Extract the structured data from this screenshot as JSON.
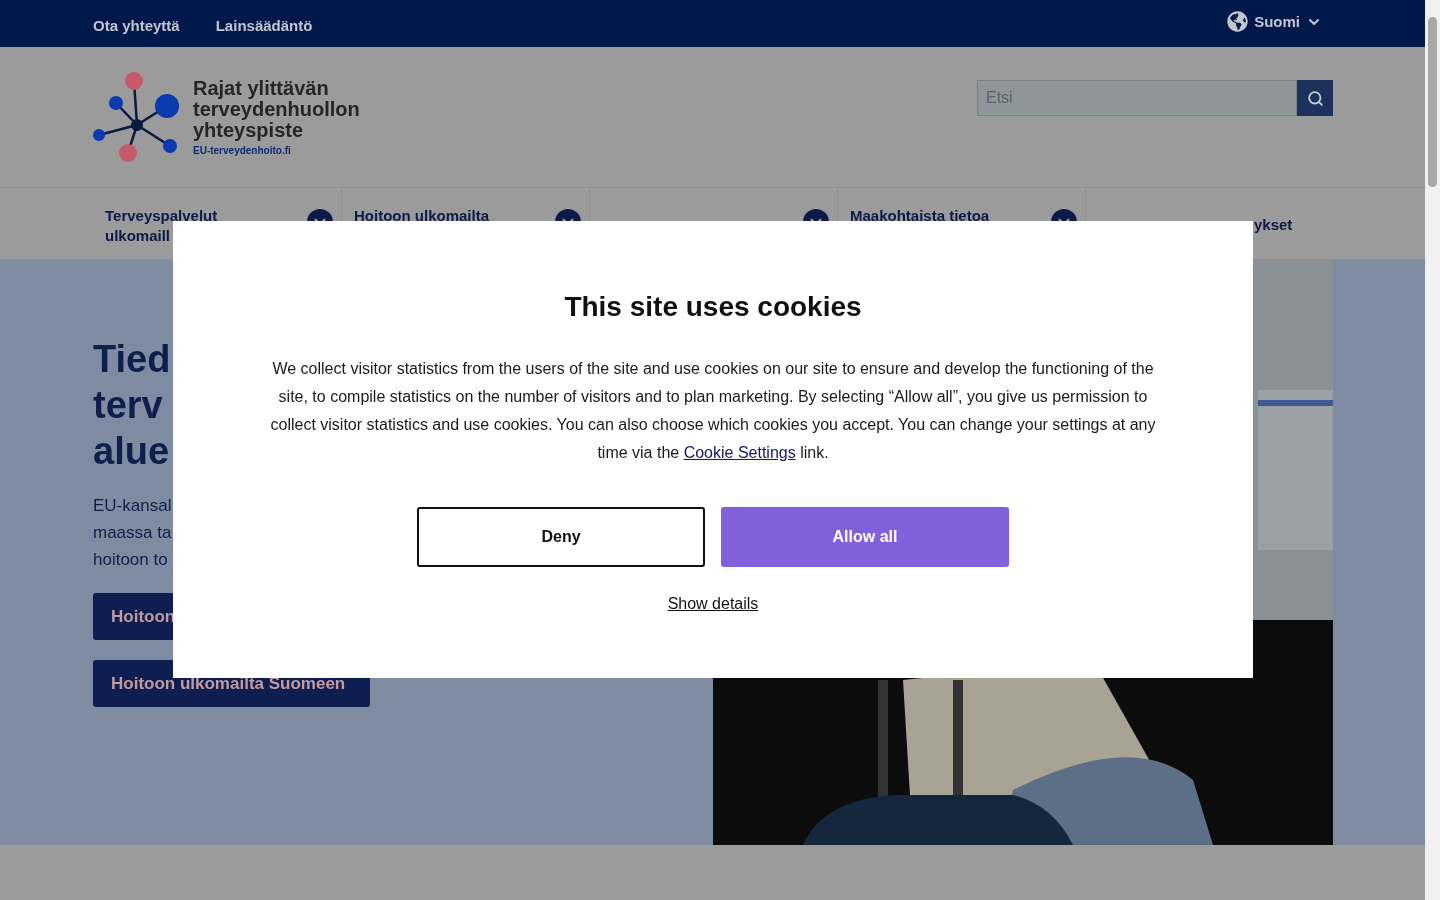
{
  "top_bar": {
    "links": [
      "Ota yhteyttä",
      "Lainsäädäntö"
    ],
    "language": "Suomi"
  },
  "header": {
    "logo": {
      "title_lines": [
        "Rajat ylittävän",
        "terveydenhuollon",
        "yhteyspiste"
      ],
      "domain": "EU-terveydenhoito.fi"
    },
    "search": {
      "placeholder": "Etsi"
    }
  },
  "nav": [
    {
      "label": "Terveyspalvelut ulkomaill",
      "has_dropdown": true
    },
    {
      "label": "Hoitoon ulkomailta",
      "has_dropdown": true
    },
    {
      "has_dropdown": true
    },
    {
      "label": "Maakohtaista tietoa",
      "has_dropdown": true
    },
    {
      "label": "ykset",
      "has_dropdown": false
    }
  ],
  "hero": {
    "heading_lines": [
      "Tied",
      "terv",
      "alue"
    ],
    "text_lines": [
      "EU-kansal",
      "maassa ta",
      "hoitoon to"
    ],
    "buttons": [
      "Hoitoon",
      "Hoitoon ulkomailta Suomeen"
    ]
  },
  "cookie_dialog": {
    "title": "This site uses cookies",
    "text_before": "We collect visitor statistics from the users of the site and use cookies on our site to ensure and develop the functioning of the site, to compile statistics on the number of visitors and to plan marketing. By selecting “Allow all”, you give us permission to collect visitor statistics and use cookies. You can also choose which cookies you accept. You can change your settings at any time via the",
    "link": "Cookie Settings",
    "text_after": "link.",
    "buttons": [
      {
        "label": "Deny",
        "kind": "secondary"
      },
      {
        "label": "Allow all",
        "kind": "primary"
      }
    ],
    "details_link": "Show details"
  }
}
